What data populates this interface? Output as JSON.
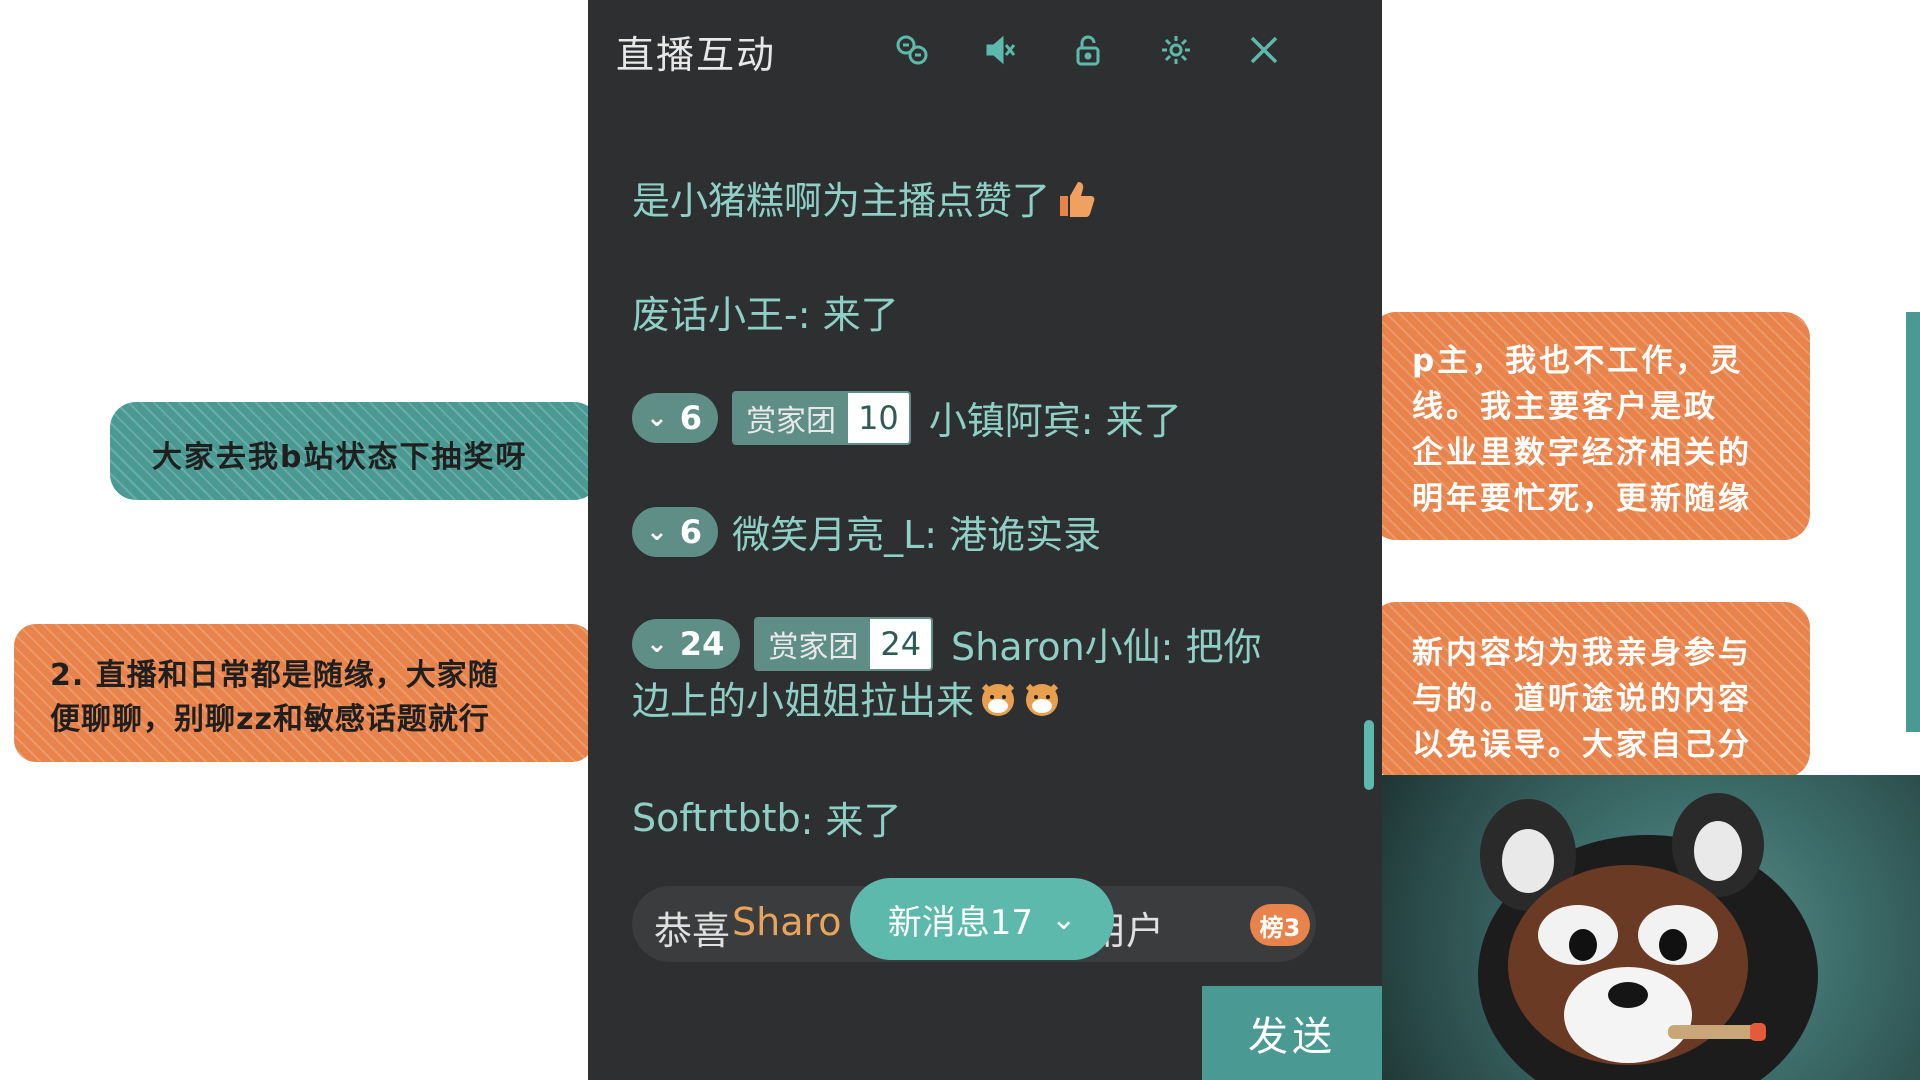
{
  "background": {
    "lottery_banner": "大家去我b站状态下抽奖呀",
    "notice_banner_line1": "2. 直播和日常都是随缘，大家随",
    "notice_banner_line2": "便聊聊，别聊zz和敏感话题就行",
    "right_banner_1_lines": [
      "p主，我也不工作，灵",
      "线。我主要客户是政",
      "企业里数字经济相关的",
      "明年要忙死，更新随缘"
    ],
    "right_banner_2_lines": [
      "新内容均为我亲身参与",
      "与的。道听途说的内容",
      "以免误导。大家自己分"
    ]
  },
  "chat_panel": {
    "title": "直播互动",
    "header_icons": [
      "translate-icon",
      "mute-icon",
      "lock-icon",
      "settings-icon",
      "close-icon"
    ],
    "messages": [
      {
        "user": "是小猪糕啊",
        "text": " 为主播点赞了",
        "emoji": "thumbs-up"
      },
      {
        "user": "废话小王-",
        "text": ": 来了"
      },
      {
        "level": "6",
        "fan_name": "赏家团",
        "fan_level": "10",
        "user": "小镇阿宾",
        "text": ": 来了"
      },
      {
        "level": "6",
        "user": "微笑月亮_L",
        "text": ": 港诡实录"
      },
      {
        "level": "24",
        "fan_name": "赏家团",
        "fan_level": "24",
        "user": "Sharon小仙",
        "text": ": 把你",
        "text_line2": "边上的小姐姐拉出来",
        "emoji": "doge"
      },
      {
        "user": "Softrtbtb",
        "text": ": 来了"
      }
    ],
    "congrats": {
      "label": "恭喜",
      "user": "Sharo",
      "tail": "能用户",
      "badge": "榜3"
    },
    "new_messages": {
      "label": "新消息17"
    },
    "send_label": "发送",
    "input_value": ""
  },
  "colors": {
    "accent": "#5eb9ad",
    "panel_bg": "#2e2f30",
    "banner_teal": "#4a9a93",
    "banner_orange": "#e8834b"
  }
}
